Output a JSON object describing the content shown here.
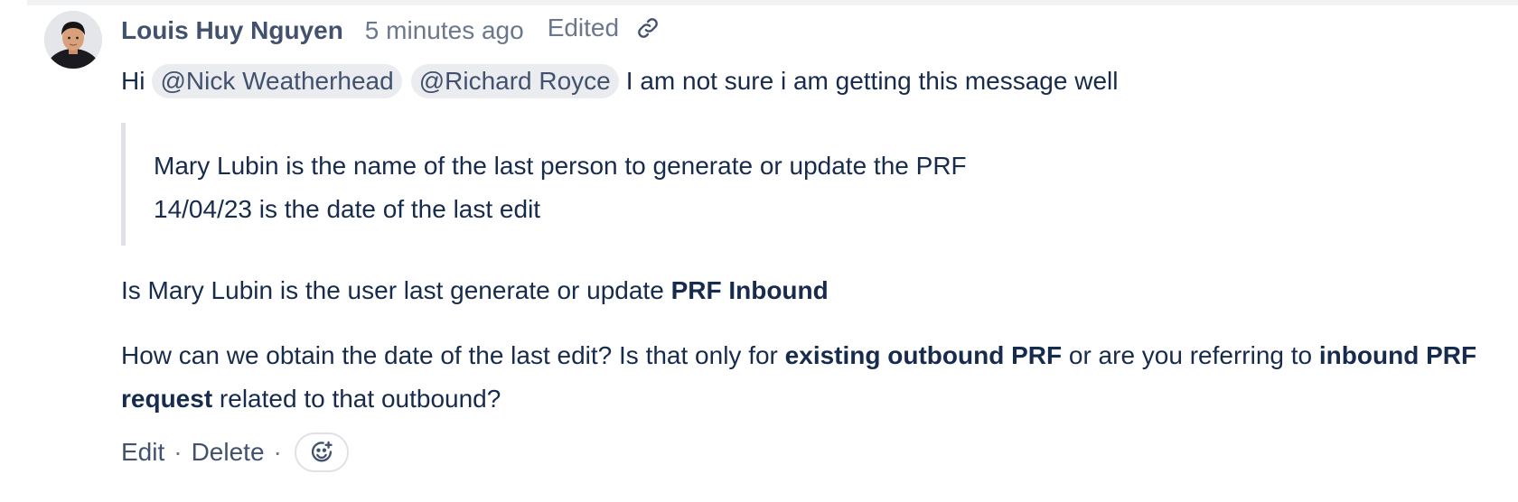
{
  "comment": {
    "author": "Louis Huy Nguyen",
    "timestamp": "5 minutes ago",
    "edited_label": "Edited",
    "greeting": "Hi",
    "mentions": [
      "@Nick Weatherhead",
      "@Richard Royce"
    ],
    "line1_rest": "I am not sure i am getting this message well",
    "quote": {
      "line1": "Mary Lubin is the name of the last person to generate or update the PRF",
      "line2": "14/04/23 is the date of the last edit"
    },
    "para1": {
      "text": "Is Mary Lubin is the user last generate or update ",
      "bold": "PRF Inbound"
    },
    "para2": {
      "part1": "How can we obtain the date of the last edit? Is that only for ",
      "bold1": "existing outbound PRF",
      "part2": " or are you referring to ",
      "bold2": "inbound PRF",
      "bold3": "request",
      "part3": " related to that outbound?"
    }
  },
  "actions": {
    "edit": "Edit",
    "separator": "·",
    "delete": "Delete"
  },
  "icons": {
    "link": "link-icon",
    "emoji": "add-reaction-icon",
    "avatar": "user-avatar"
  },
  "colors": {
    "text": "#172b4d",
    "subtle": "#42526e",
    "muted": "#6b778c",
    "mention_bg": "#ebecf0",
    "quote_border": "#dfe1e6"
  }
}
